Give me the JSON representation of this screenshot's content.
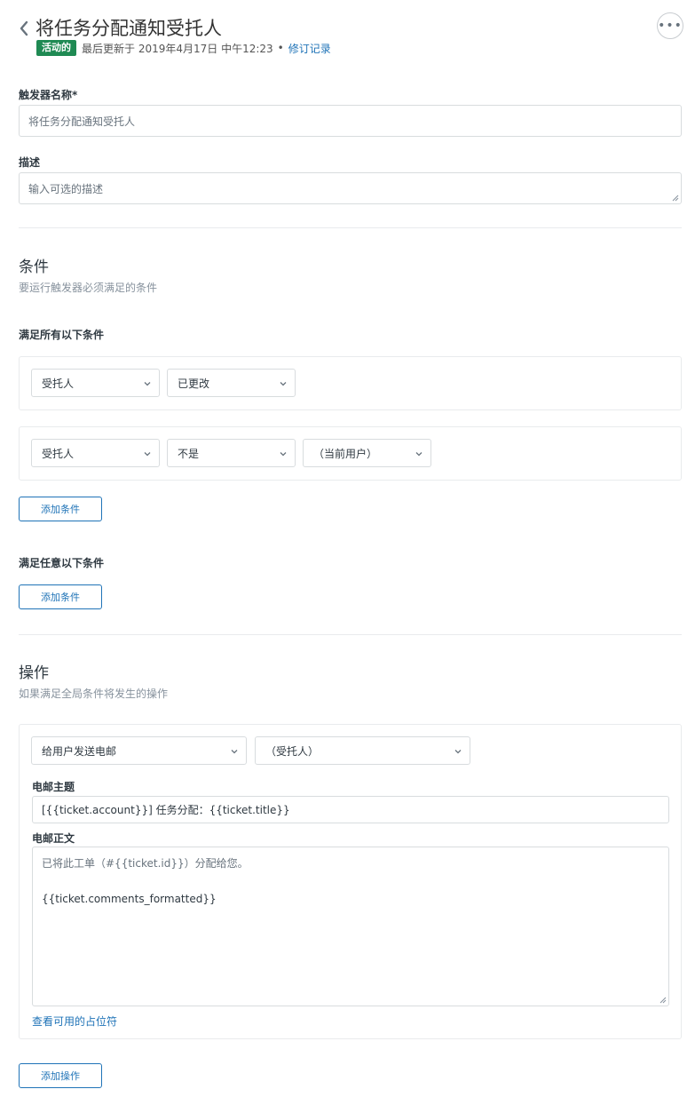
{
  "header": {
    "title": "将任务分配通知受托人",
    "status_badge": "活动的",
    "updated_text": "最后更新于 2019年4月17日 中午12:23",
    "separator": "•",
    "revisions_link": "修订记录",
    "more_label": "•••"
  },
  "form": {
    "name_label": "触发器名称*",
    "name_value": "将任务分配通知受托人",
    "description_label": "描述",
    "description_placeholder": "输入可选的描述"
  },
  "conditions": {
    "title": "条件",
    "subtitle": "要运行触发器必须满足的条件",
    "all_label": "满足所有以下条件",
    "all_rows": [
      {
        "field": "受托人",
        "operator": "已更改"
      },
      {
        "field": "受托人",
        "operator": "不是",
        "value": "（当前用户）"
      }
    ],
    "add_all_button": "添加条件",
    "any_label": "满足任意以下条件",
    "add_any_button": "添加条件"
  },
  "actions": {
    "title": "操作",
    "subtitle": "如果满足全局条件将发生的操作",
    "action_type": "给用户发送电邮",
    "action_target": "（受托人）",
    "subject_label": "电邮主题",
    "subject_value": "[{{ticket.account}}] 任务分配：{{ticket.title}}",
    "body_label": "电邮正文",
    "body_lines": [
      "已将此工单（#{{ticket.id}}）分配给您。",
      "",
      "{{ticket.comments_formatted}}"
    ],
    "placeholders_link": "查看可用的占位符",
    "add_action_button": "添加操作"
  },
  "colors": {
    "accent": "#1f73b7",
    "active_badge": "#1f8a53",
    "border": "#d8dcde"
  },
  "icons": [
    "chevron-left-icon",
    "more-icon",
    "chevron-down-icon"
  ]
}
